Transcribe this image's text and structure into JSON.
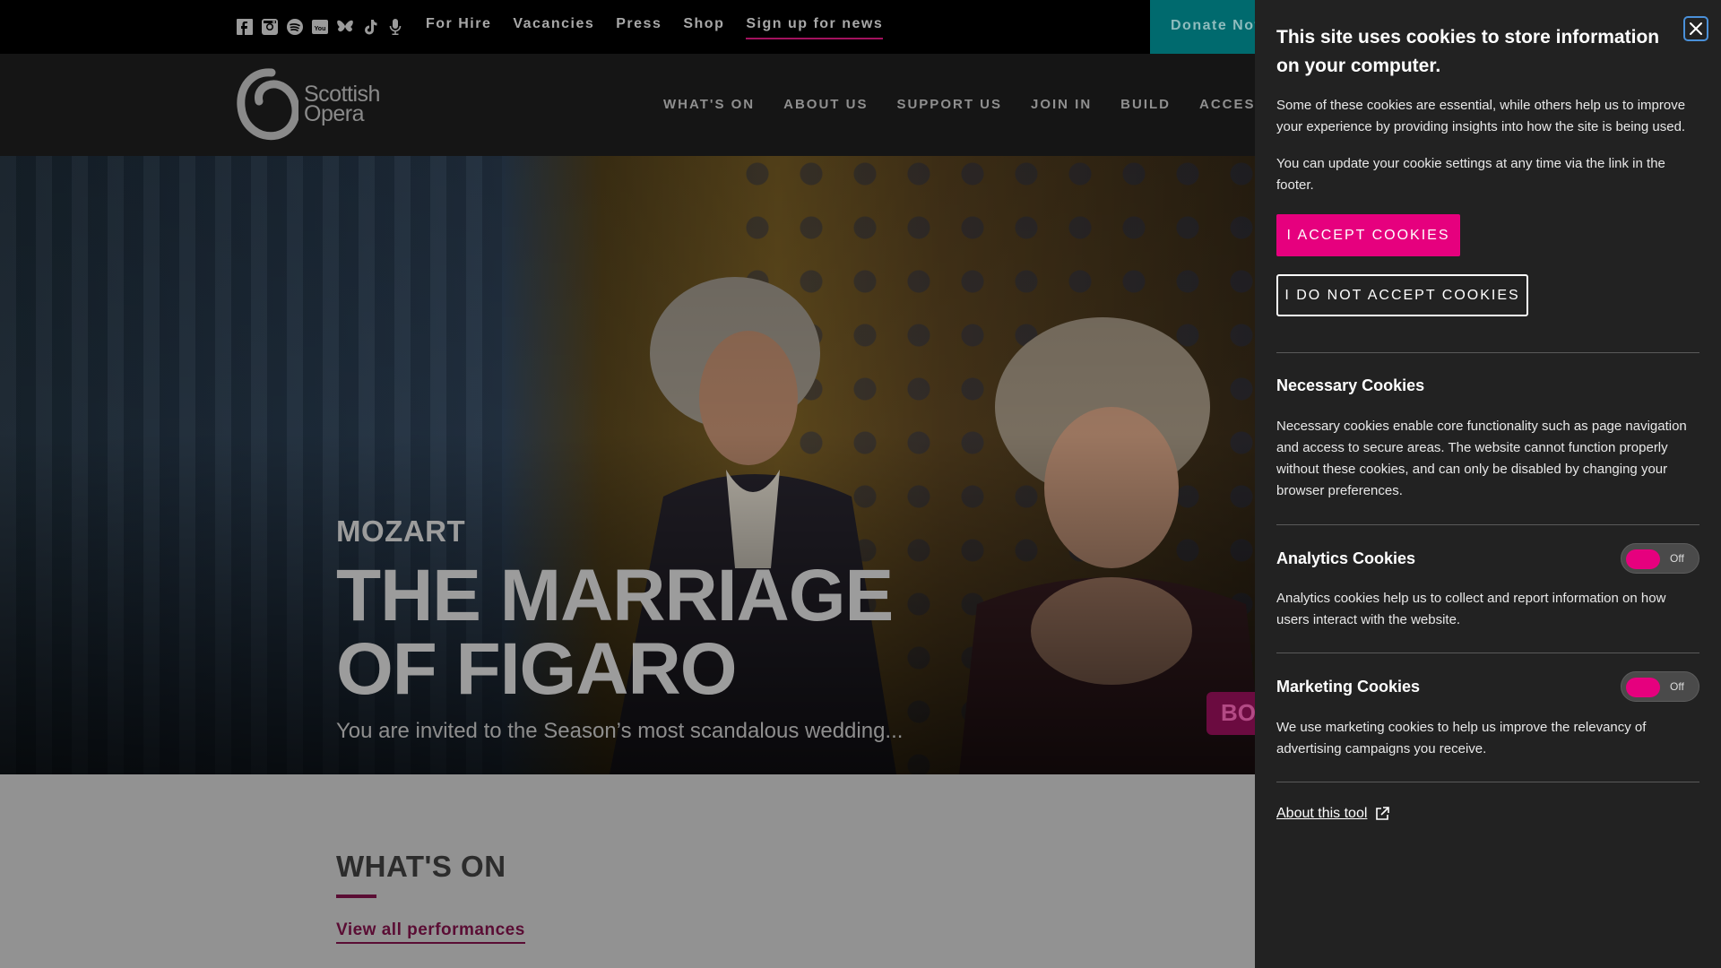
{
  "topbar": {
    "social_icons": [
      "facebook-icon",
      "instagram-icon",
      "spotify-icon",
      "youtube-icon",
      "bluesky-icon",
      "tiktok-icon",
      "microphone-icon"
    ],
    "links": [
      {
        "label": "For Hire"
      },
      {
        "label": "Vacancies"
      },
      {
        "label": "Press"
      },
      {
        "label": "Shop"
      },
      {
        "label": "Sign up for news"
      }
    ],
    "donate_label": "Donate Now"
  },
  "header": {
    "logo_line1": "Scottish",
    "logo_line2": "Opera",
    "nav": [
      {
        "label": "WHAT'S ON"
      },
      {
        "label": "ABOUT US"
      },
      {
        "label": "SUPPORT US"
      },
      {
        "label": "JOIN IN"
      },
      {
        "label": "BUILD"
      },
      {
        "label": "ACCESS"
      }
    ]
  },
  "hero": {
    "composer": "MOZART",
    "title_line1": "THE MARRIAGE",
    "title_line2": "OF FIGARO",
    "tagline": "You are invited to the Season’s most scandalous wedding...",
    "book_label": "BO"
  },
  "whats_on": {
    "title": "WHAT'S ON",
    "view_all": "View all performances"
  },
  "cookie_panel": {
    "heading": "This site uses cookies to store information on your computer.",
    "intro": "Some of these cookies are essential, while others help us to improve your experience by providing insights into how the site is being used.",
    "settings_note": "You can update your cookie settings at any time via the link in the footer.",
    "accept_label": "I ACCEPT COOKIES",
    "decline_label": "I DO NOT ACCEPT COOKIES",
    "necessary": {
      "title": "Necessary Cookies",
      "description": "Necessary cookies enable core functionality such as page navigation and access to secure areas. The website cannot function properly without these cookies, and can only be disabled by changing your browser preferences."
    },
    "analytics": {
      "title": "Analytics Cookies",
      "description": "Analytics cookies help us to collect and report information on how users interact with the website.",
      "toggle_state": "Off"
    },
    "marketing": {
      "title": "Marketing Cookies",
      "description": "We use marketing cookies to help us improve the relevancy of advertising campaigns you receive.",
      "toggle_state": "Off"
    },
    "about_link": "About this tool",
    "accent_color": "#e6007e"
  }
}
